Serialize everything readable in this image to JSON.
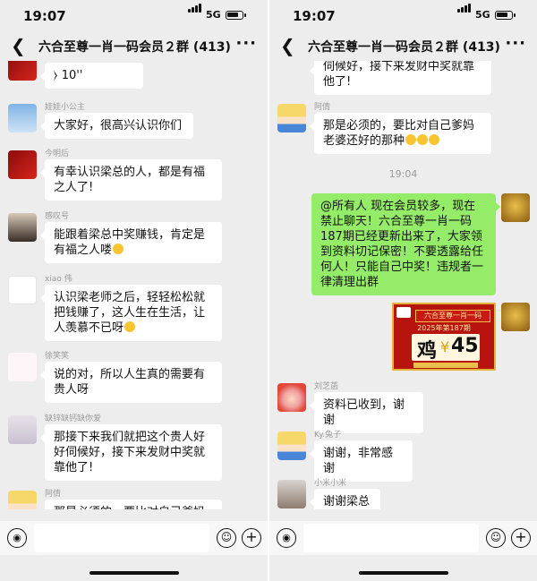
{
  "status": {
    "time": "19:07",
    "network": "5G"
  },
  "chat": {
    "title": "六合至尊一肖一码会员２群 (413)"
  },
  "left": {
    "voice_duration": "10''",
    "messages": [
      {
        "sender": "娃娃小公主",
        "text": "大家好，很高兴认识你们"
      },
      {
        "sender": "今明后",
        "text": "有幸认识梁总的人，都是有福之人了!"
      },
      {
        "sender": "感叹号",
        "text": "能跟着梁总中奖赚钱，肯定是有福之人喽"
      },
      {
        "sender": "xiao 伟",
        "text": "认识梁老师之后，轻轻松松就把钱赚了，这人生在生活，让人羡慕不已呀"
      },
      {
        "sender": "徐笑笑",
        "text": "说的对，所以人生真的需要有贵人呀"
      },
      {
        "sender": "缺锌缺钙缺你爱",
        "text": "那接下来我们就把这个贵人好好伺候好，接下来发财中奖就靠他了!"
      },
      {
        "sender": "阿倩",
        "text": "那是必须的，要比对自己爹妈老"
      }
    ]
  },
  "right": {
    "top_fragment": "伺候好，接下来发财中奖就靠他了!",
    "messages": [
      {
        "sender": "阿倩",
        "text": "那是必须的，要比对自己爹妈老婆还好的那种"
      },
      {
        "sender": "刘芝菡",
        "text": "资料已收到，谢谢"
      },
      {
        "sender": "Ky.兔子",
        "text": "谢谢，非常感谢"
      },
      {
        "sender": "小米小米",
        "text": "谢谢梁总"
      }
    ],
    "time_separator": "19:04",
    "announcement": "@所有人 现在会员较多，现在禁止聊天！六合至尊一肖一码187期已经更新出来了，大家领到资料切记保密！不要透露给任何人！只能自己中奖！违规者一律清理出群",
    "poster": {
      "banner": "六合至尊一肖一码",
      "period": "2025年第187期",
      "animal": "鸡",
      "separator": "¥",
      "number": "45"
    }
  }
}
